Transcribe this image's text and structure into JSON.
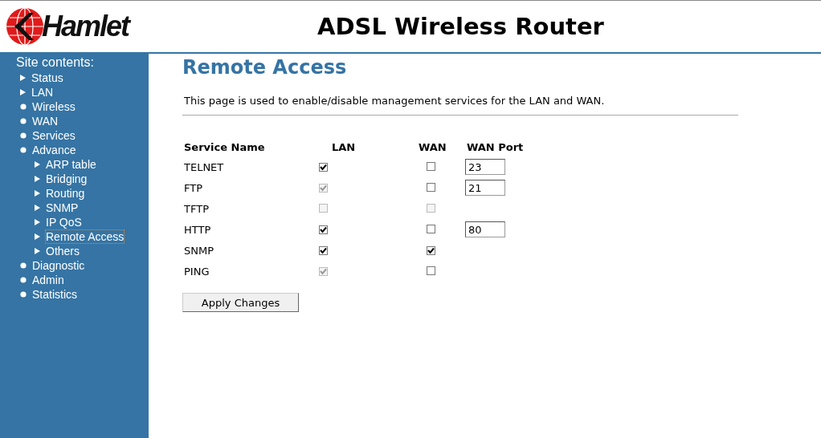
{
  "logo": {
    "text": "Hamlet"
  },
  "header": {
    "title": "ADSL Wireless Router"
  },
  "sidebar": {
    "heading": "Site contents:",
    "items": [
      {
        "label": "Status",
        "kind": "arrow",
        "selected": false
      },
      {
        "label": "LAN",
        "kind": "arrow",
        "selected": false
      },
      {
        "label": "Wireless",
        "kind": "bullet",
        "selected": false
      },
      {
        "label": "WAN",
        "kind": "bullet",
        "selected": false
      },
      {
        "label": "Services",
        "kind": "bullet",
        "selected": false
      },
      {
        "label": "Advance",
        "kind": "bullet",
        "selected": false,
        "children": [
          {
            "label": "ARP table",
            "kind": "arrow",
            "selected": false
          },
          {
            "label": "Bridging",
            "kind": "arrow",
            "selected": false
          },
          {
            "label": "Routing",
            "kind": "arrow",
            "selected": false
          },
          {
            "label": "SNMP",
            "kind": "arrow",
            "selected": false
          },
          {
            "label": "IP QoS",
            "kind": "arrow",
            "selected": false
          },
          {
            "label": "Remote Access",
            "kind": "arrow",
            "selected": true
          },
          {
            "label": "Others",
            "kind": "arrow",
            "selected": false
          }
        ]
      },
      {
        "label": "Diagnostic",
        "kind": "bullet",
        "selected": false
      },
      {
        "label": "Admin",
        "kind": "bullet",
        "selected": false
      },
      {
        "label": "Statistics",
        "kind": "bullet",
        "selected": false
      }
    ]
  },
  "page": {
    "title": "Remote Access",
    "description": "This page is used to enable/disable management services for the LAN and WAN."
  },
  "table": {
    "columns": [
      "Service Name",
      "LAN",
      "WAN",
      "WAN Port"
    ],
    "rows": [
      {
        "name": "TELNET",
        "lan": {
          "checked": true,
          "disabled": false
        },
        "wan": {
          "checked": false,
          "disabled": false
        },
        "port": "23"
      },
      {
        "name": "FTP",
        "lan": {
          "checked": true,
          "disabled": true
        },
        "wan": {
          "checked": false,
          "disabled": false
        },
        "port": "21"
      },
      {
        "name": "TFTP",
        "lan": {
          "checked": false,
          "disabled": true
        },
        "wan": {
          "checked": false,
          "disabled": true
        }
      },
      {
        "name": "HTTP",
        "lan": {
          "checked": true,
          "disabled": false
        },
        "wan": {
          "checked": false,
          "disabled": false
        },
        "port": "80"
      },
      {
        "name": "SNMP",
        "lan": {
          "checked": true,
          "disabled": false
        },
        "wan": {
          "checked": true,
          "disabled": false
        }
      },
      {
        "name": "PING",
        "lan": {
          "checked": true,
          "disabled": true
        },
        "wan": {
          "checked": false,
          "disabled": false
        }
      }
    ]
  },
  "buttons": [
    "Apply Changes"
  ]
}
